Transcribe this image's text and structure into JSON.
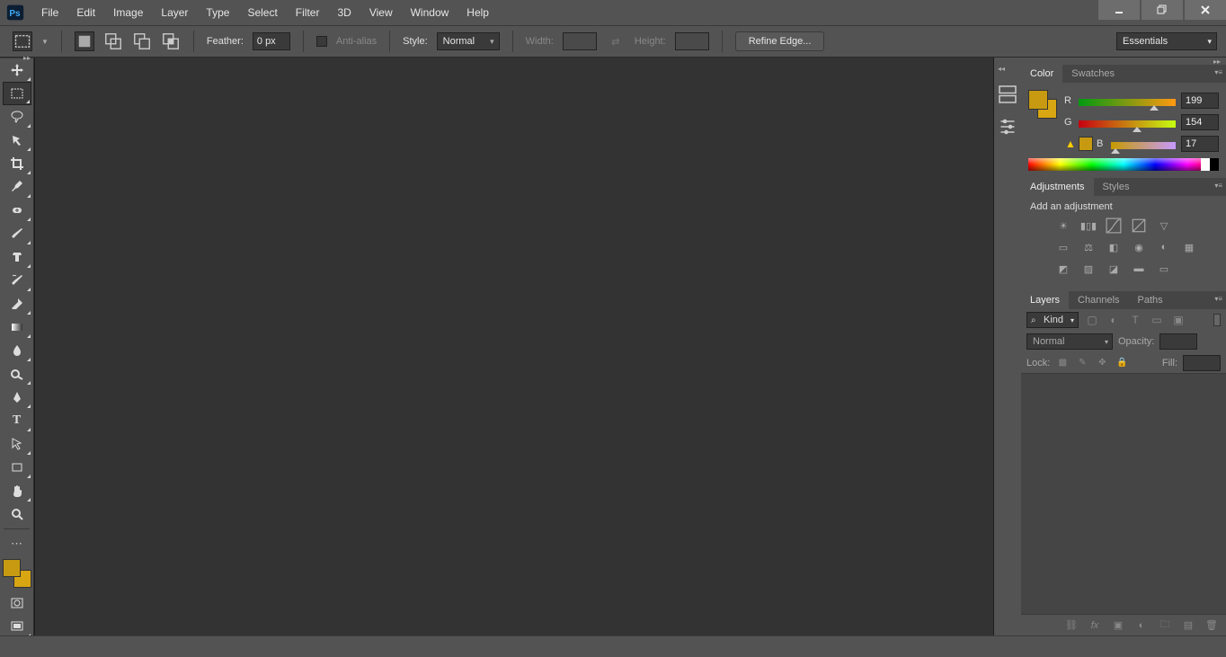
{
  "menu": {
    "items": [
      "File",
      "Edit",
      "Image",
      "Layer",
      "Type",
      "Select",
      "Filter",
      "3D",
      "View",
      "Window",
      "Help"
    ]
  },
  "options": {
    "feather_label": "Feather:",
    "feather_value": "0 px",
    "antialias_label": "Anti-alias",
    "style_label": "Style:",
    "style_value": "Normal",
    "width_label": "Width:",
    "width_value": "",
    "height_label": "Height:",
    "height_value": "",
    "refine_label": "Refine Edge...",
    "workspace": "Essentials"
  },
  "color_panel": {
    "tabs": [
      "Color",
      "Swatches"
    ],
    "active_tab": 0,
    "fg_color": "#c79a11",
    "bg_color": "#d8a612",
    "channels": [
      {
        "label": "R",
        "value": "199",
        "pct": 78,
        "gradient": "linear-gradient(to right,#009a11,#ff9a11)"
      },
      {
        "label": "G",
        "value": "154",
        "pct": 60,
        "gradient": "linear-gradient(to right,#c70011,#c7ff11)"
      },
      {
        "label": "B",
        "value": "17",
        "pct": 7,
        "gradient": "linear-gradient(to right,#c79a00,#c79aff)"
      }
    ]
  },
  "adjustments_panel": {
    "tabs": [
      "Adjustments",
      "Styles"
    ],
    "active_tab": 0,
    "label": "Add an adjustment"
  },
  "layers_panel": {
    "tabs": [
      "Layers",
      "Channels",
      "Paths"
    ],
    "active_tab": 0,
    "filter_kind": "Kind",
    "blend_mode": "Normal",
    "opacity_label": "Opacity:",
    "opacity_value": "",
    "lock_label": "Lock:",
    "fill_label": "Fill:",
    "fill_value": ""
  }
}
